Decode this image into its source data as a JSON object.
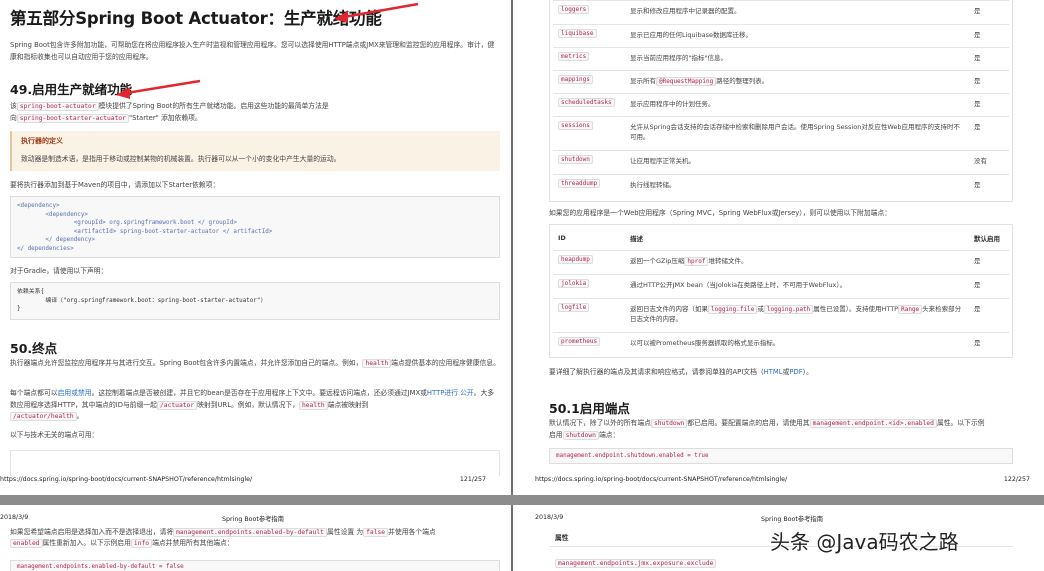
{
  "left_page": {
    "part_title": "第五部分Spring Boot Actuator：生产就绪功能",
    "intro": "Spring Boot包含许多附加功能，可帮助您在将应用程序投入生产时监视和管理应用程序。您可以选择使用HTTP端点或JMX来管理和监控您的应用程序。审计，健康和指标收集也可以自动应用于您的应用程序。",
    "chapter_title": "49.启用生产就绪功能",
    "chapter_p1_a": "该",
    "chapter_p1_code1": "spring-boot-actuator",
    "chapter_p1_b": "模块提供了Spring Boot的所有生产就绪功能。启用这些功能的最简单方法是",
    "chapter_p1_c": "向",
    "chapter_p1_code2": "spring-boot-starter-actuator",
    "chapter_p1_d": "\"Starter\" 添加依赖项。",
    "sidebar_title": "执行器的定义",
    "sidebar_text": "致动器是制造术语，是指用于移动或控制某物的机械装置。执行器可以从一个小的变化中产生大量的运动。",
    "maven_text": "要将执行器添加到基于Maven的项目中，请添加以下Starter依赖项：",
    "maven_code": [
      "<dependency>",
      "        <dependency>",
      "                <groupId> org.springframework.boot </ groupId>",
      "                <artifactId> spring-boot-starter-actuator </ artifactId>",
      "        </ dependency>",
      "</ dependencies>"
    ],
    "gradle_text": "对于Gradle，请使用以下声明：",
    "gradle_code": [
      "依赖关系{",
      "        编译（\"org.springframework.boot：spring-boot-starter-actuator\"）",
      "}"
    ],
    "section_title": "50.终点",
    "endpoints_p1_a": "执行器端点允许您监控应用程序并与其进行交互。Spring Boot包含许多内置端点，并允许您添加自己的端点。例如，",
    "endpoints_p1_code": "health",
    "endpoints_p1_b": "端点提供基本的应用程序健康信息。",
    "endpoints_p2_a": "每个端点都可以",
    "endpoints_p2_link1": "启用或禁用",
    "endpoints_p2_b": "。这控制着端点是否被创建，并且它的bean是否存在于应用程序上下文中。要远程访问端点，还必须通过JMX或",
    "endpoints_p2_link2": "HTTP进行 公开",
    "endpoints_p2_c": "。大多数应用程序选择HTTP，其中端点的ID与前缀一起",
    "endpoints_p2_code1": "/actuator",
    "endpoints_p2_d": "映射到URL。例如，默认情况下，",
    "endpoints_p2_code2": "health",
    "endpoints_p2_e": "端点被映射到",
    "endpoints_p2_code3": "/actuator/health",
    "endpoints_p2_f": "。",
    "tech_text": "以下与技术无关的端点可用：",
    "footer_url": "https://docs.spring.io/spring-boot/docs/current-SNAPSHOT/reference/htmlsingle/",
    "footer_page": "121/257"
  },
  "right_page": {
    "rows1": [
      {
        "id": "loggers",
        "desc": "显示和修改应用程序中记录器的配置。",
        "enabled": "是"
      },
      {
        "id": "liquibase",
        "desc": "显示已应用的任何Liquibase数据库迁移。",
        "enabled": "是"
      },
      {
        "id": "metrics",
        "desc": "显示当前应用程序的\"指标\"信息。",
        "enabled": "是"
      },
      {
        "id": "mappings",
        "desc_a": "显示所有",
        "desc_code": "@RequestMapping",
        "desc_b": "路径的整理列表。",
        "enabled": "是"
      },
      {
        "id": "scheduledtasks",
        "desc": "显示应用程序中的计划任务。",
        "enabled": "是"
      },
      {
        "id": "sessions",
        "desc": "允许从Spring会话支持的会话存储中检索和删除用户会话。使用Spring Session对反应性Web应用程序的支持时不可用。",
        "enabled": "是"
      },
      {
        "id": "shutdown",
        "desc": "让应用程序正常关机。",
        "enabled": "没有"
      },
      {
        "id": "threaddump",
        "desc": "执行线程转储。",
        "enabled": "是"
      }
    ],
    "web_text": "如果您的应用程序是一个Web应用程序（Spring MVC，Spring WebFlux或Jersey），则可以使用以下附加端点：",
    "table2_headers": {
      "id": "ID",
      "desc": "描述",
      "enabled": "默认启用"
    },
    "rows2": [
      {
        "id": "heapdump",
        "desc_a": "返回一个GZip压缩",
        "desc_code": "hprof",
        "desc_b": "堆转储文件。",
        "enabled": "是"
      },
      {
        "id": "jolokia",
        "desc": "通过HTTP公开JMX bean（当Jolokia在类路径上时，不可用于WebFlux）。",
        "enabled": "是"
      },
      {
        "id": "logfile",
        "desc_a": "返回日志文件的内容（如果",
        "desc_code": "logging.file",
        "desc_b": "或",
        "desc_code2": "logging.path",
        "desc_c": "属性已设置）。支持使用HTTP",
        "desc_code3": "Range",
        "desc_d": "头来检索部分日志文件的内容。",
        "enabled": "是"
      },
      {
        "id": "prometheus",
        "desc": "以可以被Prometheus服务器抓取的格式显示指标。",
        "enabled": "是"
      }
    ],
    "api_text_a": "要详细了解执行器的端点及其请求和响应格式，请参阅单独的API文档（",
    "api_link1": "HTML",
    "api_text_b": "或",
    "api_link2": "PDF",
    "api_text_c": "）。",
    "sub_title": "50.1启用端点",
    "sub_p_a": "默认情况下，除了以外的所有端点",
    "sub_p_code1": "shutdown",
    "sub_p_b": "都已启用。要配置端点的启用，请使用其",
    "sub_p_code2": "management.endpoint.<id>.enabled",
    "sub_p_c": "属性。以下示例",
    "sub_p_d": "启用",
    "sub_p_code3": "shutdown",
    "sub_p_e": "端点：",
    "sub_code": "management.endpoint.shutdown.enabled = true",
    "footer_url": "https://docs.spring.io/spring-boot/docs/current-SNAPSHOT/reference/htmlsingle/",
    "footer_page": "122/257"
  },
  "bottom_left": {
    "date": "2018/3/9",
    "header": "Spring Boot参考指南",
    "text_a": "如果您希望端点启用是选择加入而不是选择退出，请将",
    "text_code1": "management.endpoints.enabled-by-default",
    "text_b": "属性设置 为",
    "text_code2": "false",
    "text_c": "并使用各个端点",
    "text_code3": "enabled",
    "text_d": "属性重新加入。以下示例启用",
    "text_code4": "info",
    "text_e": "端点并禁用所有其他端点：",
    "code": "management.endpoints.enabled-by-default = false"
  },
  "bottom_right": {
    "date": "2018/3/9",
    "header": "Spring Boot参考指南",
    "prop_header": "属性",
    "prop_code": "management.endpoints.jmx.exposure.exclude"
  },
  "watermark": "头条 @Java码农之路",
  "colors": {
    "arrow": "#e0262f",
    "code": "#b0284e",
    "link": "#2a6fc7",
    "sidebar_bg": "#fbf2e6"
  }
}
